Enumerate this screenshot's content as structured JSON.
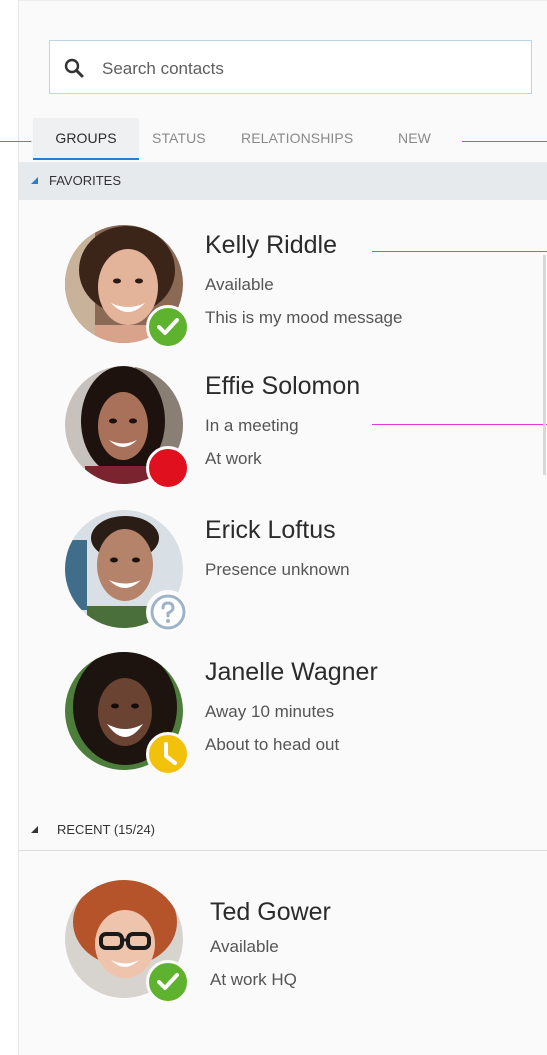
{
  "search": {
    "placeholder": "Search contacts",
    "value": ""
  },
  "tabs": [
    {
      "label": "GROUPS",
      "active": true
    },
    {
      "label": "STATUS",
      "active": false
    },
    {
      "label": "RELATIONSHIPS",
      "active": false
    },
    {
      "label": "NEW",
      "active": false
    }
  ],
  "groups": {
    "favorites": {
      "label": "FAVORITES",
      "expanded": true
    },
    "recent": {
      "label": "RECENT (15/24)",
      "expanded": true
    }
  },
  "contacts": [
    {
      "name": "Kelly Riddle",
      "status": "Available",
      "note": "This is my mood message",
      "presence": "available-icon"
    },
    {
      "name": "Effie Solomon",
      "status": "In a meeting",
      "note": "At work",
      "presence": "busy-icon"
    },
    {
      "name": "Erick Loftus",
      "status": "Presence unknown",
      "note": "",
      "presence": "unknown-icon"
    },
    {
      "name": "Janelle Wagner",
      "status": "Away 10 minutes",
      "note": "About to head out",
      "presence": "away-icon"
    },
    {
      "name": "Ted Gower",
      "status": "Available",
      "note": "At work HQ",
      "presence": "available-icon"
    }
  ],
  "colors": {
    "accent": "#2b7bd1",
    "available": "#5fb22d",
    "busy": "#e0101f",
    "away": "#f2c20a",
    "unknown": "#9fb3c8",
    "callout": "#e13ccf"
  }
}
